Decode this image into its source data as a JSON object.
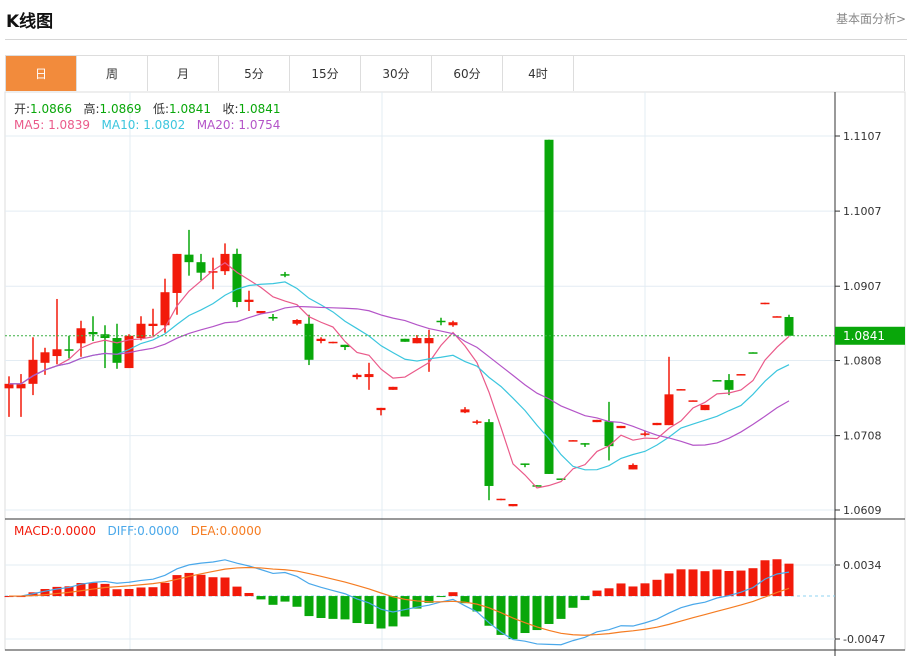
{
  "header": {
    "title": "K线图",
    "fundamental_link": "基本面分析>"
  },
  "tabs": [
    {
      "label": "日",
      "active": true
    },
    {
      "label": "周"
    },
    {
      "label": "月"
    },
    {
      "label": "5分"
    },
    {
      "label": "15分"
    },
    {
      "label": "30分"
    },
    {
      "label": "60分"
    },
    {
      "label": "4时"
    }
  ],
  "ohlc": {
    "open_label": "开:",
    "open": "1.0866",
    "high_label": "高:",
    "high": "1.0869",
    "low_label": "低:",
    "low": "1.0841",
    "close_label": "收:",
    "close": "1.0841"
  },
  "ma": {
    "ma5_label": "MA5:",
    "ma5": "1.0839",
    "ma10_label": "MA10:",
    "ma10": "1.0802",
    "ma20_label": "MA20:",
    "ma20": "1.0754"
  },
  "macd_legend": {
    "macd": "MACD:0.0000",
    "diff": "DIFF:0.0000",
    "dea": "DEA:0.0000"
  },
  "current_price": "1.0841",
  "colors": {
    "up": "#f21a0a",
    "down": "#09a70a",
    "ma5": "#ea5a8a",
    "ma10": "#3cc6de",
    "ma20": "#b455c8",
    "diff": "#4aa8ea",
    "dea": "#f57c22",
    "accent": "#f28b3c"
  },
  "chart_data": {
    "type": "candlestick",
    "price_ticks": [
      "1.1107",
      "1.1007",
      "1.0907",
      "1.0808",
      "1.0708",
      "1.0609"
    ],
    "price_range": [
      1.0609,
      1.1107
    ],
    "macd_ticks": [
      "0.0034",
      "-0.0047"
    ],
    "macd_range": [
      -0.0047,
      0.0034
    ],
    "candles": [
      [
        1.0771,
        1.0777,
        1.0787,
        1.0733
      ],
      [
        1.0771,
        1.0777,
        1.079,
        1.0733
      ],
      [
        1.0777,
        1.0809,
        1.0839,
        1.0762
      ],
      [
        1.0805,
        1.0819,
        1.0825,
        1.0789
      ],
      [
        1.0814,
        1.0823,
        1.089,
        1.0803
      ],
      [
        1.0823,
        1.0821,
        1.0841,
        1.0811
      ],
      [
        1.0831,
        1.0851,
        1.0861,
        1.0813
      ],
      [
        1.0846,
        1.0843,
        1.0867,
        1.0834
      ],
      [
        1.0843,
        1.0838,
        1.0855,
        1.0798
      ],
      [
        1.0838,
        1.0805,
        1.0857,
        1.0797
      ],
      [
        1.0798,
        1.0841,
        1.0843,
        1.0798
      ],
      [
        1.0838,
        1.0857,
        1.0867,
        1.0835
      ],
      [
        1.0854,
        1.0857,
        1.0877,
        1.0841
      ],
      [
        1.0855,
        1.0899,
        1.0917,
        1.0845
      ],
      [
        1.0898,
        1.095,
        1.095,
        1.0869
      ],
      [
        1.0949,
        1.0939,
        1.0982,
        1.0921
      ],
      [
        1.0939,
        1.0925,
        1.095,
        1.0915
      ],
      [
        1.0926,
        1.0927,
        1.0945,
        1.0903
      ],
      [
        1.0927,
        1.095,
        1.0964,
        1.0922
      ],
      [
        1.095,
        1.0886,
        1.0957,
        1.0879
      ],
      [
        1.0886,
        1.0889,
        1.0901,
        1.0874
      ],
      [
        1.0871,
        1.0874,
        1.0874,
        1.0871
      ],
      [
        1.0866,
        1.0865,
        1.087,
        1.0861
      ],
      [
        1.0923,
        1.0922,
        1.0926,
        1.0919
      ],
      [
        1.0857,
        1.0862,
        1.0863,
        1.0855
      ],
      [
        1.0857,
        1.0809,
        1.0869,
        1.0802
      ],
      [
        1.0834,
        1.0837,
        1.0839,
        1.0831
      ],
      [
        1.0831,
        1.0833,
        1.0833,
        1.0831
      ],
      [
        1.0829,
        1.0826,
        1.0829,
        1.0822
      ],
      [
        1.0786,
        1.0789,
        1.0791,
        1.0783
      ],
      [
        1.0786,
        1.079,
        1.0805,
        1.0769
      ],
      [
        1.0742,
        1.0745,
        1.0745,
        1.0735
      ],
      [
        1.0769,
        1.0773,
        1.0773,
        1.0769
      ],
      [
        1.0837,
        1.0833,
        1.0837,
        1.0833
      ],
      [
        1.0831,
        1.0838,
        1.0842,
        1.0831
      ],
      [
        1.0831,
        1.0838,
        1.0849,
        1.0793
      ],
      [
        1.0861,
        1.0859,
        1.0865,
        1.0855
      ],
      [
        1.0855,
        1.0859,
        1.0861,
        1.0853
      ],
      [
        1.0739,
        1.0743,
        1.0746,
        1.0738
      ],
      [
        1.0725,
        1.0727,
        1.0729,
        1.0723
      ],
      [
        1.0726,
        1.0641,
        1.073,
        1.0622
      ],
      [
        1.0622,
        1.0624,
        1.0624,
        1.0622
      ],
      [
        1.0614,
        1.0617,
        1.0617,
        1.0614
      ],
      [
        1.0671,
        1.0669,
        1.0671,
        1.0666
      ],
      [
        1.0642,
        1.0641,
        1.0642,
        1.0641
      ],
      [
        1.1102,
        1.0657,
        1.1102,
        1.0657
      ],
      [
        1.0651,
        1.065,
        1.0651,
        1.065
      ],
      [
        1.0701,
        1.0702,
        1.0702,
        1.0701
      ],
      [
        1.0698,
        1.0697,
        1.0698,
        1.0693
      ],
      [
        1.0726,
        1.0729,
        1.0729,
        1.0726
      ],
      [
        1.0727,
        1.0694,
        1.0753,
        1.0675
      ],
      [
        1.0718,
        1.0721,
        1.0721,
        1.0718
      ],
      [
        1.0663,
        1.0669,
        1.0671,
        1.0663
      ],
      [
        1.071,
        1.0711,
        1.0715,
        1.0707
      ],
      [
        1.0722,
        1.0725,
        1.0725,
        1.0722
      ],
      [
        1.0722,
        1.0763,
        1.0813,
        1.0722
      ],
      [
        1.0769,
        1.077,
        1.077,
        1.0769
      ],
      [
        1.0754,
        1.0755,
        1.0755,
        1.0754
      ],
      [
        1.0742,
        1.0749,
        1.0749,
        1.0742
      ],
      [
        1.0782,
        1.0781,
        1.0782,
        1.0781
      ],
      [
        1.0782,
        1.0769,
        1.079,
        1.0762
      ],
      [
        1.0789,
        1.079,
        1.079,
        1.0789
      ],
      [
        1.0819,
        1.0818,
        1.0819,
        1.0818
      ],
      [
        1.0883,
        1.0885,
        1.0885,
        1.0883
      ],
      [
        1.0866,
        1.0867,
        1.0867,
        1.0866
      ],
      [
        1.0866,
        1.0841,
        1.0869,
        1.0841
      ]
    ]
  }
}
